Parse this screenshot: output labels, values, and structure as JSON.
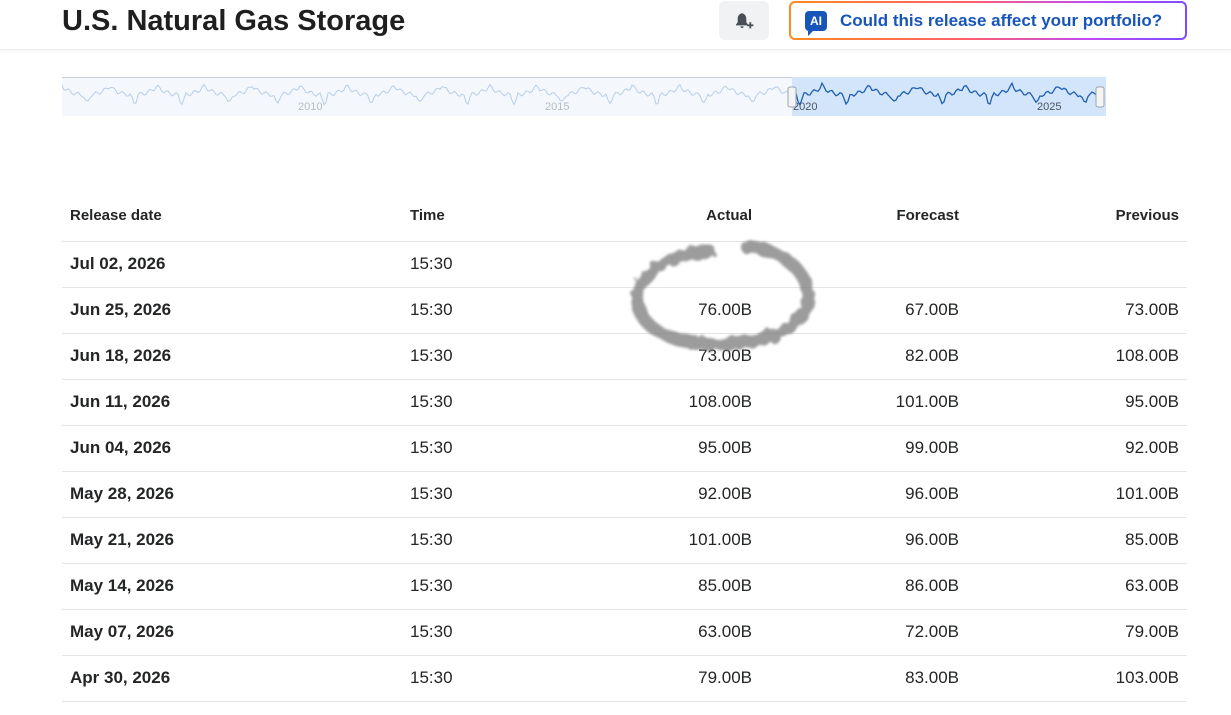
{
  "header": {
    "title": "U.S. Natural Gas Storage",
    "alert_icon": "bell-plus-icon",
    "ai_badge": "AI",
    "ai_prompt": "Could this release affect your portfolio?"
  },
  "timeline": {
    "year_labels": [
      "2010",
      "2015",
      "2020",
      "2025"
    ]
  },
  "table": {
    "headers": {
      "release_date": "Release date",
      "time": "Time",
      "actual": "Actual",
      "forecast": "Forecast",
      "previous": "Previous"
    },
    "rows": [
      {
        "date": "Jul 02, 2026",
        "time": "15:30",
        "actual": "",
        "actual_status": "",
        "forecast": "",
        "previous": ""
      },
      {
        "date": "Jun 25, 2026",
        "time": "15:30",
        "actual": "76.00B",
        "actual_status": "neg",
        "forecast": "67.00B",
        "previous": "73.00B"
      },
      {
        "date": "Jun 18, 2026",
        "time": "15:30",
        "actual": "73.00B",
        "actual_status": "pos",
        "forecast": "82.00B",
        "previous": "108.00B"
      },
      {
        "date": "Jun 11, 2026",
        "time": "15:30",
        "actual": "108.00B",
        "actual_status": "neg",
        "forecast": "101.00B",
        "previous": "95.00B"
      },
      {
        "date": "Jun 04, 2026",
        "time": "15:30",
        "actual": "95.00B",
        "actual_status": "pos",
        "forecast": "99.00B",
        "previous": "92.00B"
      },
      {
        "date": "May 28, 2026",
        "time": "15:30",
        "actual": "92.00B",
        "actual_status": "pos",
        "forecast": "96.00B",
        "previous": "101.00B"
      },
      {
        "date": "May 21, 2026",
        "time": "15:30",
        "actual": "101.00B",
        "actual_status": "neg",
        "forecast": "96.00B",
        "previous": "85.00B"
      },
      {
        "date": "May 14, 2026",
        "time": "15:30",
        "actual": "85.00B",
        "actual_status": "pos",
        "forecast": "86.00B",
        "previous": "63.00B"
      },
      {
        "date": "May 07, 2026",
        "time": "15:30",
        "actual": "63.00B",
        "actual_status": "pos",
        "forecast": "72.00B",
        "previous": "79.00B"
      },
      {
        "date": "Apr 30, 2026",
        "time": "15:30",
        "actual": "79.00B",
        "actual_status": "pos",
        "forecast": "83.00B",
        "previous": "103.00B"
      }
    ]
  },
  "colors": {
    "positive": "#0e8a35",
    "negative": "#d91e18",
    "ai_accent": "#1756b8"
  }
}
